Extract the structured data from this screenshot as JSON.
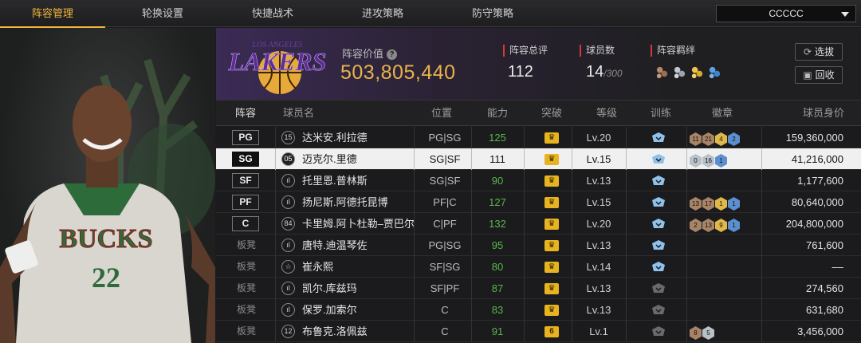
{
  "nav": {
    "tabs": [
      {
        "label": "阵容管理",
        "active": true
      },
      {
        "label": "轮换设置",
        "active": false
      },
      {
        "label": "快捷战术",
        "active": false
      },
      {
        "label": "进攻策略",
        "active": false
      },
      {
        "label": "防守策略",
        "active": false
      }
    ],
    "team_selector": "CCCCC"
  },
  "portrait": {
    "jersey_text": "BUCKS",
    "jersey_number": "22"
  },
  "header": {
    "logo_city": "LOS ANGELES",
    "logo_text": "LAKERS",
    "value_label": "阵容价值",
    "value": "503,805,440",
    "overall_label": "阵容总评",
    "overall_value": "112",
    "count_label": "球员数",
    "count_value": "14",
    "count_max": "/300",
    "synergy_label": "阵容羁绊",
    "pick_button": "选拔",
    "recycle_button": "回收"
  },
  "table": {
    "headers": {
      "lineup": "阵容",
      "name": "球员名",
      "position": "位置",
      "ability": "能力",
      "breakthrough": "突破",
      "level": "等级",
      "training": "训练",
      "badges": "徽章",
      "salary": "球员身价"
    },
    "rows": [
      {
        "slot": "PG",
        "starter": true,
        "num": "15",
        "name": "达米安.利拉德",
        "position": "PG|SG",
        "ability": "125",
        "break": "♛",
        "level": "Lv.20",
        "train": "blue",
        "badges": [
          {
            "v": "11",
            "c": "bronze"
          },
          {
            "v": "21",
            "c": "bronze"
          },
          {
            "v": "4",
            "c": "gold"
          },
          {
            "v": "2",
            "c": "blue"
          }
        ],
        "salary": "159,360,000"
      },
      {
        "slot": "SG",
        "starter": true,
        "num": "05",
        "name": "迈克尔.里德",
        "position": "SG|SF",
        "ability": "111",
        "break": "♛",
        "level": "Lv.15",
        "train": "blue",
        "badges": [
          {
            "v": "0",
            "c": "silver"
          },
          {
            "v": "16",
            "c": "silver"
          },
          {
            "v": "1",
            "c": "blue"
          }
        ],
        "salary": "41,216,000",
        "selected": true
      },
      {
        "slot": "SF",
        "starter": true,
        "num": "ıl",
        "name": "托里恩.普林斯",
        "position": "SG|SF",
        "ability": "90",
        "break": "♛",
        "level": "Lv.13",
        "train": "blue",
        "badges": [],
        "salary": "1,177,600"
      },
      {
        "slot": "PF",
        "starter": true,
        "num": "ıl",
        "name": "扬尼斯.阿德托昆博",
        "position": "PF|C",
        "ability": "127",
        "break": "♛",
        "level": "Lv.15",
        "train": "blue",
        "badges": [
          {
            "v": "13",
            "c": "bronze"
          },
          {
            "v": "17",
            "c": "bronze"
          },
          {
            "v": "1",
            "c": "gold"
          },
          {
            "v": "1",
            "c": "blue"
          }
        ],
        "salary": "80,640,000"
      },
      {
        "slot": "C",
        "starter": true,
        "num": "84",
        "name": "卡里姆.阿卜杜勒–贾巴尔",
        "position": "C|PF",
        "ability": "132",
        "break": "♛",
        "level": "Lv.20",
        "train": "blue",
        "badges": [
          {
            "v": "2",
            "c": "bronze"
          },
          {
            "v": "13",
            "c": "bronze"
          },
          {
            "v": "9",
            "c": "gold"
          },
          {
            "v": "1",
            "c": "blue"
          }
        ],
        "salary": "204,800,000"
      },
      {
        "slot": "板凳",
        "starter": false,
        "num": "ıl",
        "name": "唐特.迪温琴佐",
        "position": "PG|SG",
        "ability": "95",
        "break": "♛",
        "level": "Lv.13",
        "train": "blue",
        "badges": [],
        "salary": "761,600"
      },
      {
        "slot": "板凳",
        "starter": false,
        "num": "☆",
        "name": "崔永熙",
        "position": "SF|SG",
        "ability": "80",
        "break": "♛",
        "level": "Lv.14",
        "train": "blue",
        "badges": [],
        "salary": "––"
      },
      {
        "slot": "板凳",
        "starter": false,
        "num": "ıl",
        "name": "凯尔.库兹玛",
        "position": "SF|PF",
        "ability": "87",
        "break": "♛",
        "level": "Lv.13",
        "train": "gray",
        "badges": [],
        "salary": "274,560"
      },
      {
        "slot": "板凳",
        "starter": false,
        "num": "ıl",
        "name": "保罗.加索尔",
        "position": "C",
        "ability": "83",
        "break": "♛",
        "level": "Lv.13",
        "train": "gray",
        "badges": [],
        "salary": "631,680"
      },
      {
        "slot": "板凳",
        "starter": false,
        "num": "12",
        "name": "布鲁克.洛佩兹",
        "position": "C",
        "ability": "91",
        "break": "6",
        "level": "Lv.1",
        "train": "gray",
        "badges": [
          {
            "v": "8",
            "c": "bronze"
          },
          {
            "v": "5",
            "c": "silver"
          }
        ],
        "salary": "3,456,000"
      }
    ]
  },
  "colors": {
    "accent": "#f2b63c",
    "value_gold": "#e9b349",
    "ability_green": "#58b84a",
    "lakers_purple": "#552583"
  }
}
